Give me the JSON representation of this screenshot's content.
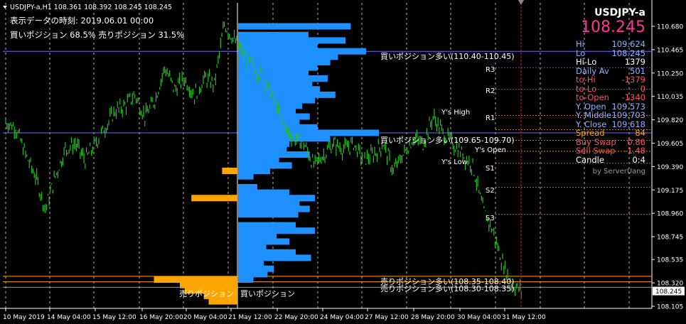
{
  "header": {
    "symbol_line": "USDJPY-a,H1  108.361 108.392 108.245 108.245",
    "display_time_label": "表示データの時刻: 2019.06.01 00:00",
    "position_ratio": "買いポジション 68.5% 売りポジション 31.5%"
  },
  "panel": {
    "symbol": "USDJPY-a",
    "price": "108.245",
    "rows": [
      {
        "label": "Hi",
        "value": "109.624",
        "color": "#8fb4ff"
      },
      {
        "label": "Lo",
        "value": "108.245",
        "color": "#8fb4ff"
      },
      {
        "label": "Hi-Lo",
        "value": "1379",
        "color": "#ffffff"
      },
      {
        "label": "Daily Av",
        "value": "501",
        "color": "#8fb4ff"
      },
      {
        "label": "to-Hi",
        "value": "-1379",
        "color": "#ff5060"
      },
      {
        "label": "to-Lo",
        "value": "0",
        "color": "#ff5060"
      },
      {
        "label": "to-Open",
        "value": "-1340",
        "color": "#ff5060"
      },
      {
        "label": "Y. Open",
        "value": "109.573",
        "color": "#8fb4ff"
      },
      {
        "label": "Y. Middle",
        "value": "109.703",
        "color": "#8fb4ff"
      },
      {
        "label": "Y. Close",
        "value": "109.618",
        "color": "#8fb4ff"
      },
      {
        "label": "Spread",
        "value": "84",
        "color": "#ffa500"
      },
      {
        "label": "Buy Swap",
        "value": "0.86",
        "color": "#ff5060"
      },
      {
        "label": "Sell Swap",
        "value": "-1.48",
        "color": "#ff5060"
      },
      {
        "label": "Candle",
        "value": "0:4",
        "color": "#ffffff"
      }
    ],
    "credit": "by ServerUang"
  },
  "annotations": {
    "buy_zone_1": "買いポジション多い(110.40-110.45)",
    "buy_zone_2": "買いポジション多い(109.65-109.70)",
    "sell_zone_1": "売りポジション多い(108.35-108.40)",
    "sell_zone_2": "売りポジション多い(108.30-108.35)",
    "sell_label": "売りポジション",
    "buy_label": "買いポジション",
    "pivots": [
      "R3",
      "R2",
      "R1",
      "S1",
      "S2",
      "S3"
    ],
    "y_high": "Y's High",
    "y_open": "Y's Open",
    "y_low": "Y's Low"
  },
  "price_axis": {
    "ticks": [
      "110.680",
      "110.465",
      "110.250",
      "110.035",
      "109.820",
      "109.605",
      "109.390",
      "109.175",
      "108.960",
      "108.745",
      "108.535",
      "108.320",
      "108.105"
    ],
    "current": "108.245"
  },
  "time_axis": {
    "labels": [
      "10 May 2019",
      "14 May 04:00",
      "15 May 12:00",
      "16 May 20:00",
      "20 May 04:00",
      "21 May 12:00",
      "22 May 20:00",
      "24 May 04:00",
      "27 May 12:00",
      "28 May 20:00",
      "30 May 04:00",
      "31 May 12:00"
    ]
  },
  "colors": {
    "background": "#000000",
    "candles": "#22c022",
    "buy_bars": "#1e90ff",
    "sell_bars": "#ffa500",
    "grid": "#ffffff",
    "hline": "#6b6bff",
    "price_big": "#ff3399"
  },
  "chart_data": {
    "type": "line",
    "ylim": [
      108.105,
      110.68
    ],
    "series": [
      {
        "values": [
          109.8,
          109.75,
          109.5,
          109.3,
          109.0,
          109.3,
          109.55,
          109.6,
          109.45,
          109.6,
          109.75,
          109.9,
          109.95,
          110.05,
          109.85,
          110.0,
          110.3,
          110.1,
          110.2,
          110.05,
          110.2,
          110.15,
          110.7,
          110.55,
          110.4,
          110.3,
          110.2,
          110.0,
          109.75,
          109.65,
          109.6,
          109.4,
          109.5,
          109.6,
          109.55,
          109.6,
          109.45,
          109.5,
          109.6,
          109.35,
          109.5,
          109.65,
          109.6,
          109.85,
          109.7,
          109.6,
          109.5,
          109.4,
          109.0,
          108.8,
          108.5,
          108.3,
          108.245
        ]
      }
    ],
    "buy_volume_profile": [
      {
        "price": 110.68,
        "value": 0.88
      },
      {
        "price": 110.6,
        "value": 0.55
      },
      {
        "price": 110.55,
        "value": 0.84
      },
      {
        "price": 110.5,
        "value": 0.62
      },
      {
        "price": 110.45,
        "value": 1.0
      },
      {
        "price": 110.4,
        "value": 0.78
      },
      {
        "price": 110.35,
        "value": 0.72
      },
      {
        "price": 110.3,
        "value": 0.62
      },
      {
        "price": 110.25,
        "value": 0.55
      },
      {
        "price": 110.2,
        "value": 0.7
      },
      {
        "price": 110.15,
        "value": 0.58
      },
      {
        "price": 110.1,
        "value": 0.64
      },
      {
        "price": 110.05,
        "value": 0.76
      },
      {
        "price": 110.0,
        "value": 0.6
      },
      {
        "price": 109.95,
        "value": 0.5
      },
      {
        "price": 109.9,
        "value": 0.45
      },
      {
        "price": 109.85,
        "value": 0.56
      },
      {
        "price": 109.8,
        "value": 0.48
      },
      {
        "price": 109.75,
        "value": 0.62
      },
      {
        "price": 109.7,
        "value": 1.1
      },
      {
        "price": 109.65,
        "value": 0.72
      },
      {
        "price": 109.6,
        "value": 0.4
      },
      {
        "price": 109.55,
        "value": 0.38
      },
      {
        "price": 109.5,
        "value": 0.56
      },
      {
        "price": 109.45,
        "value": 0.32
      },
      {
        "price": 109.4,
        "value": 0.42
      },
      {
        "price": 109.35,
        "value": 0.25
      },
      {
        "price": 109.3,
        "value": 0.12
      },
      {
        "price": 109.2,
        "value": 0.15
      },
      {
        "price": 109.15,
        "value": 0.4
      },
      {
        "price": 109.1,
        "value": 0.6
      },
      {
        "price": 109.05,
        "value": 0.48
      },
      {
        "price": 109.0,
        "value": 0.56
      },
      {
        "price": 108.95,
        "value": 0.47
      },
      {
        "price": 108.85,
        "value": 0.45
      },
      {
        "price": 108.8,
        "value": 0.6
      },
      {
        "price": 108.75,
        "value": 0.3
      },
      {
        "price": 108.7,
        "value": 0.4
      },
      {
        "price": 108.65,
        "value": 0.22
      },
      {
        "price": 108.6,
        "value": 0.45
      },
      {
        "price": 108.55,
        "value": 0.57
      },
      {
        "price": 108.5,
        "value": 0.2
      },
      {
        "price": 108.45,
        "value": 0.28
      },
      {
        "price": 108.4,
        "value": 0.23
      },
      {
        "price": 108.35,
        "value": 0.12
      }
    ],
    "sell_volume_profile": [
      {
        "price": 109.35,
        "value": 0.16
      },
      {
        "price": 109.1,
        "value": 0.48
      },
      {
        "price": 108.35,
        "value": 0.87
      },
      {
        "price": 108.3,
        "value": 0.6
      },
      {
        "price": 108.25,
        "value": 0.55
      },
      {
        "price": 108.2,
        "value": 0.35
      },
      {
        "price": 108.15,
        "value": 0.3
      }
    ]
  }
}
